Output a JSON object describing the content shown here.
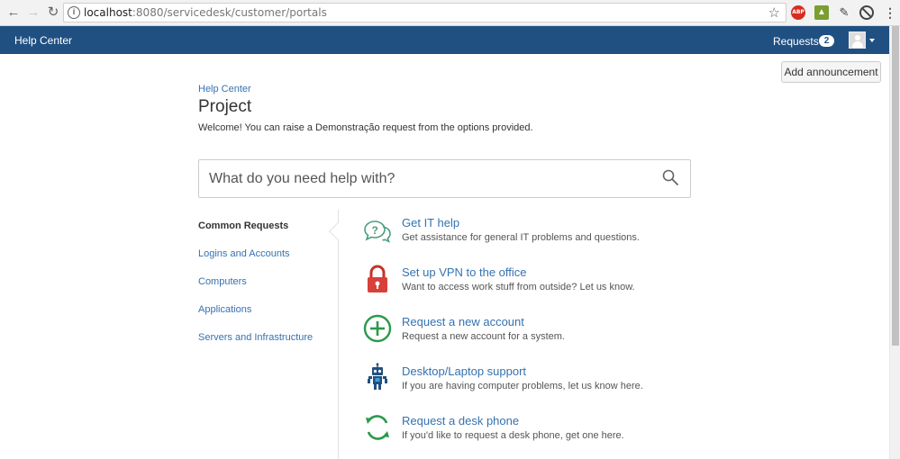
{
  "browser": {
    "url_host": "localhost",
    "url_rest": ":8080/servicedesk/customer/portals",
    "ext_abp": "ABP"
  },
  "header": {
    "brand": "Help Center",
    "requests_label": "Requests",
    "requests_count": "2",
    "brand_color": "#205081"
  },
  "actions": {
    "add_announcement": "Add announcement"
  },
  "portal": {
    "breadcrumb": "Help Center",
    "title": "Project",
    "welcome": "Welcome! You can raise a Demonstração request from the options provided."
  },
  "search": {
    "placeholder": "What do you need help with?"
  },
  "categories": [
    {
      "label": "Common Requests",
      "active": true
    },
    {
      "label": "Logins and Accounts",
      "active": false
    },
    {
      "label": "Computers",
      "active": false
    },
    {
      "label": "Applications",
      "active": false
    },
    {
      "label": "Servers and Infrastructure",
      "active": false
    }
  ],
  "request_types": [
    {
      "title": "Get IT help",
      "description": "Get assistance for general IT problems and questions.",
      "icon": "chat-question-icon"
    },
    {
      "title": "Set up VPN to the office",
      "description": "Want to access work stuff from outside? Let us know.",
      "icon": "padlock-icon"
    },
    {
      "title": "Request a new account",
      "description": "Request a new account for a system.",
      "icon": "plus-circle-icon"
    },
    {
      "title": "Desktop/Laptop support",
      "description": "If you are having computer problems, let us know here.",
      "icon": "robot-icon"
    },
    {
      "title": "Request a desk phone",
      "description": "If you'd like to request a desk phone, get one here.",
      "icon": "refresh-arrows-icon"
    }
  ]
}
